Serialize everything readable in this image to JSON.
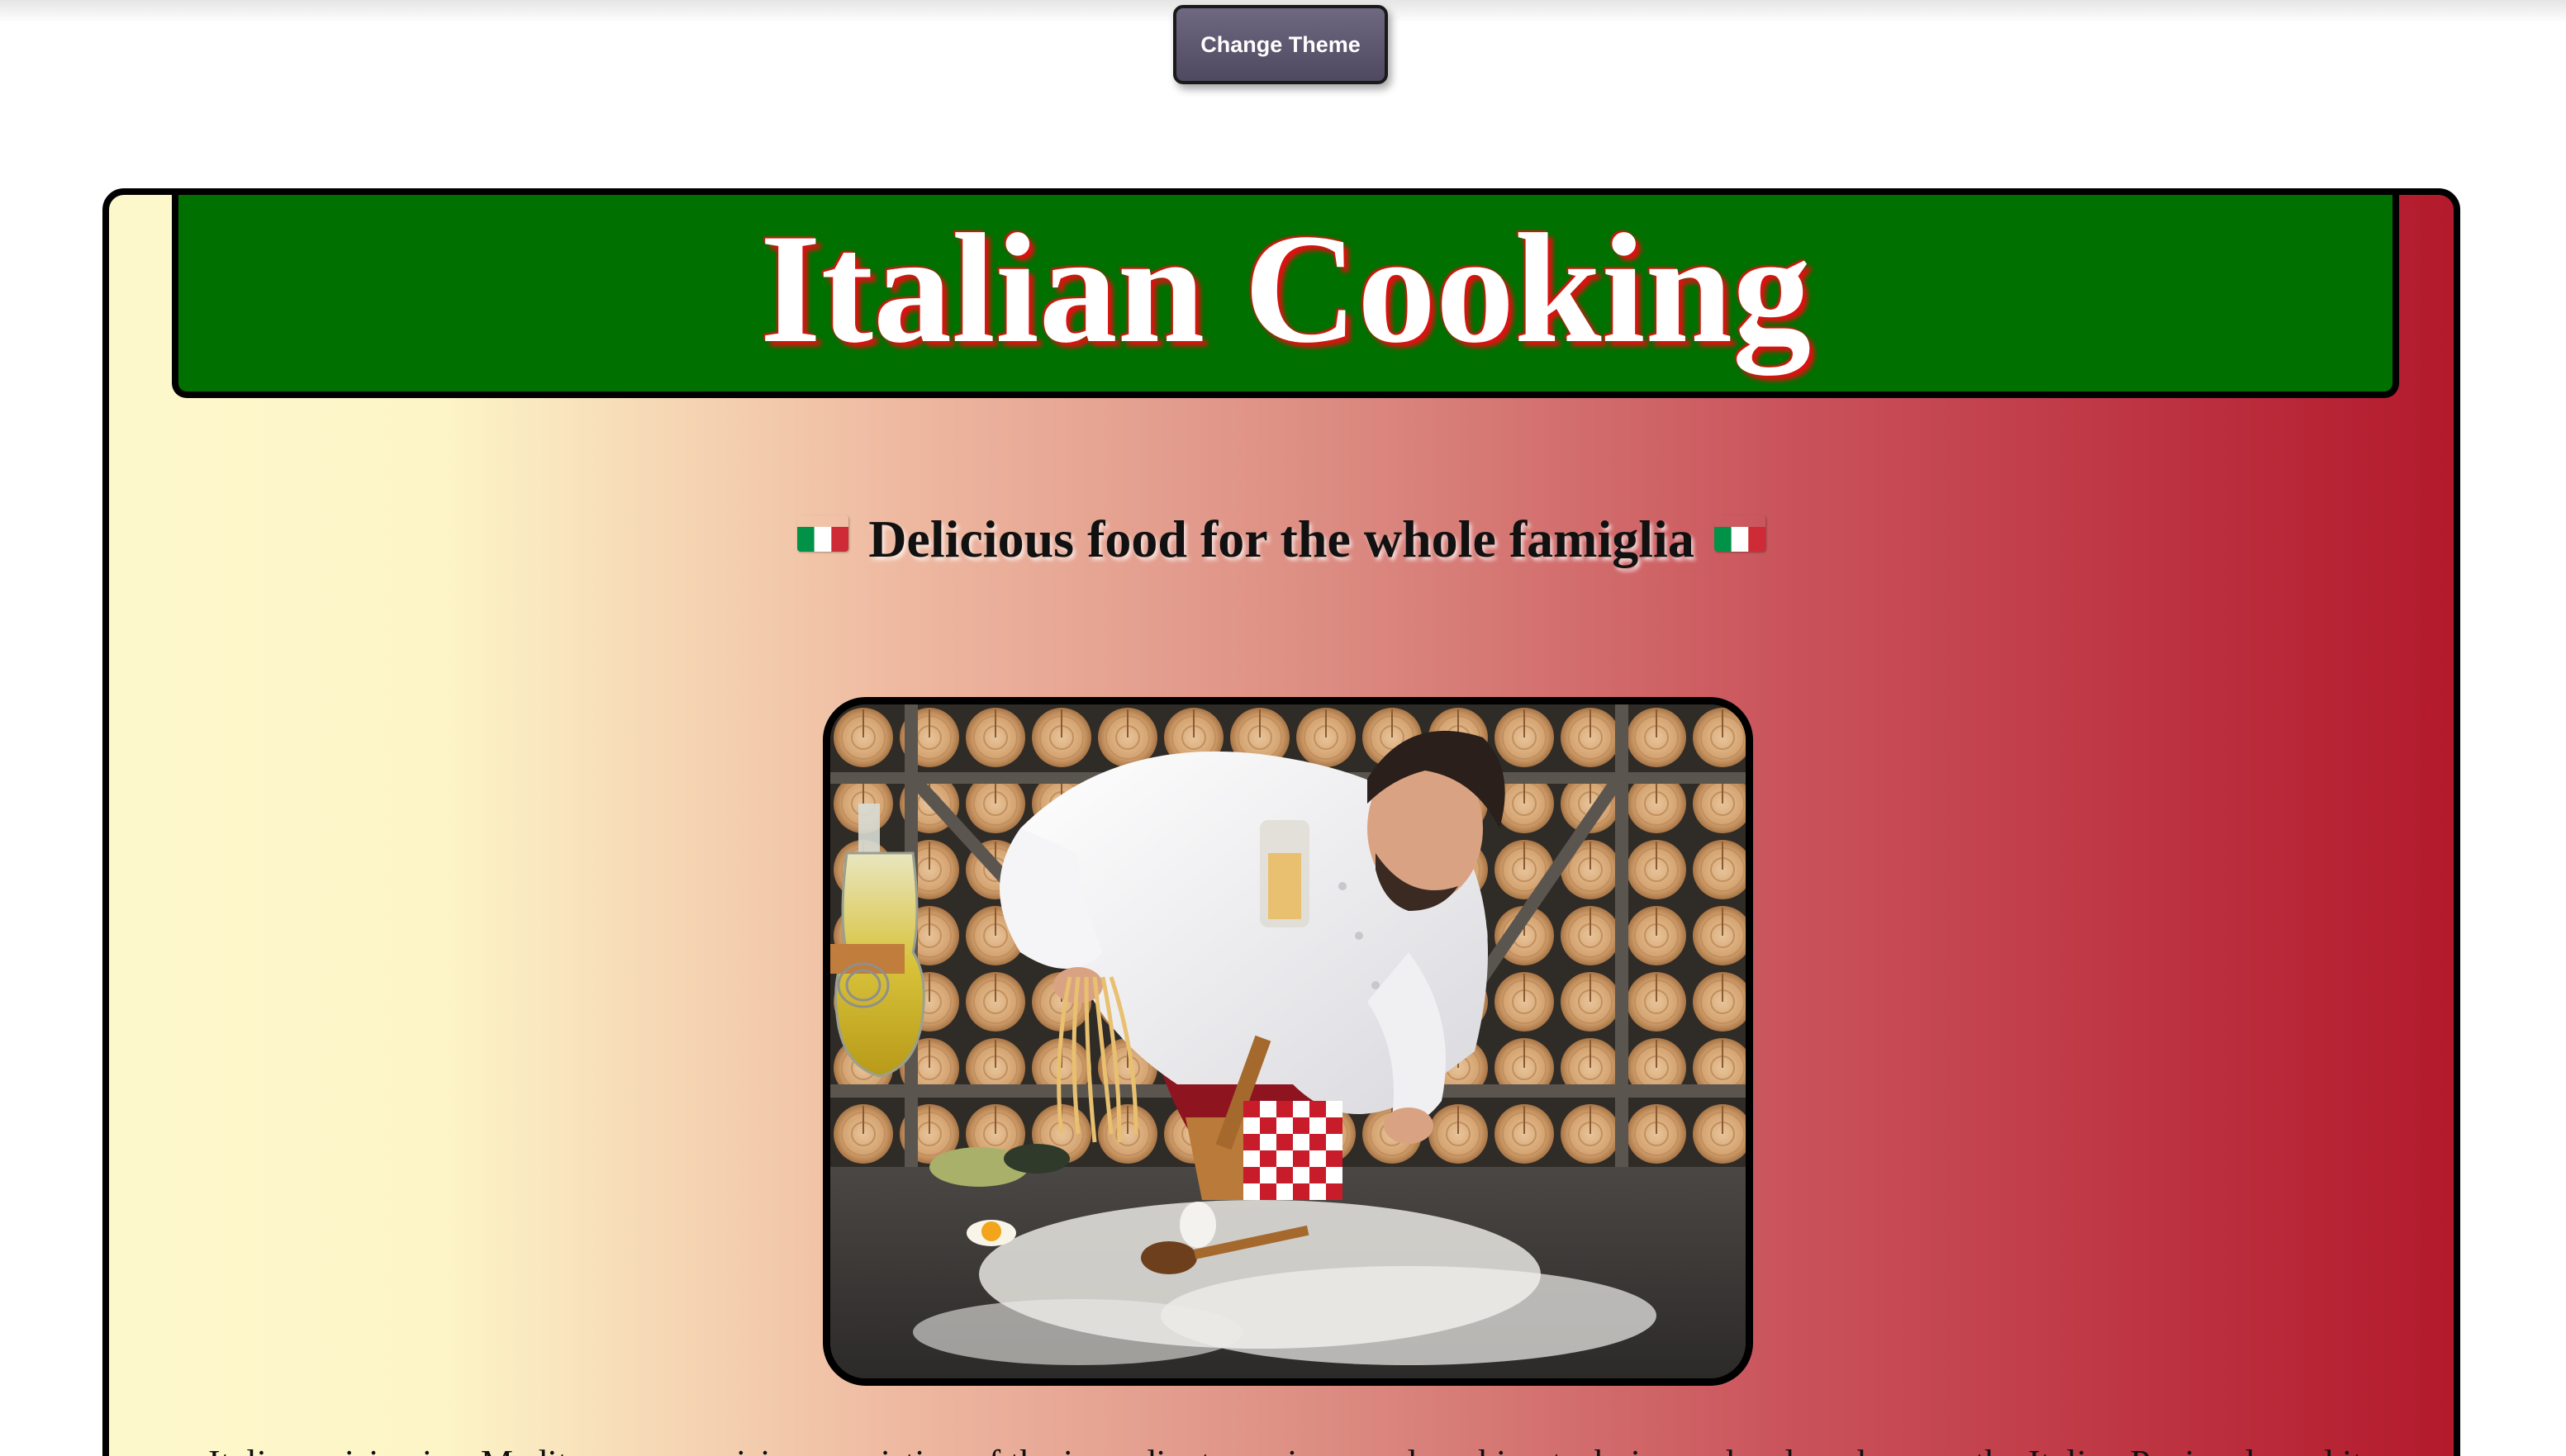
{
  "toolbar": {
    "theme_button_label": "Change Theme"
  },
  "header": {
    "title": "Italian Cooking"
  },
  "main": {
    "subtitle": "Delicious food for the whole famiglia",
    "hero_image_icon": "chef-making-pasta-photo",
    "intro_text": "Italian cuisine is a Mediterranean cuisine consisting of the ingredients, recipes, and cooking techniques developed across the Italian Peninsula and its"
  },
  "colors": {
    "banner_green": "#007000",
    "title_shadow_red": "#e01010",
    "gradient_start": "#fdf8cc",
    "gradient_end": "#b31a2c",
    "button_bg": "#5c566e"
  }
}
